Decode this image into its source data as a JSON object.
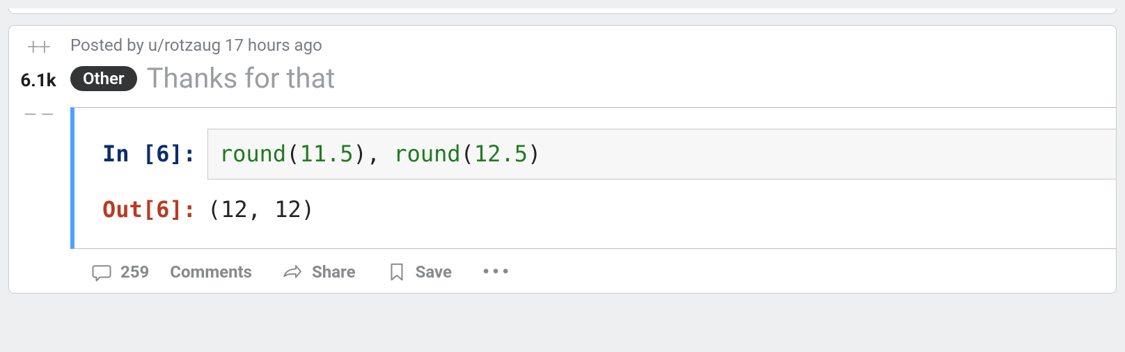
{
  "post": {
    "byline_prefix": "Posted by ",
    "author_prefix": "u/",
    "author": "rotzaug",
    "age": "17 hours ago",
    "score": "6.1k",
    "flair": "Other",
    "title": "Thanks for that"
  },
  "code": {
    "in_prompt": "In [6]:",
    "out_prompt": "Out[6]:",
    "fn1": "round",
    "open1": "(",
    "arg1": "11.5",
    "close1": ")",
    "comma": ", ",
    "fn2": "round",
    "open2": "(",
    "arg2": "12.5",
    "close2": ")",
    "output": "(12, 12)"
  },
  "actions": {
    "comments_count": "259",
    "comments_label": "Comments",
    "share": "Share",
    "save": "Save"
  },
  "vote": {
    "up_glyph": "++",
    "down_glyph": "– –"
  }
}
